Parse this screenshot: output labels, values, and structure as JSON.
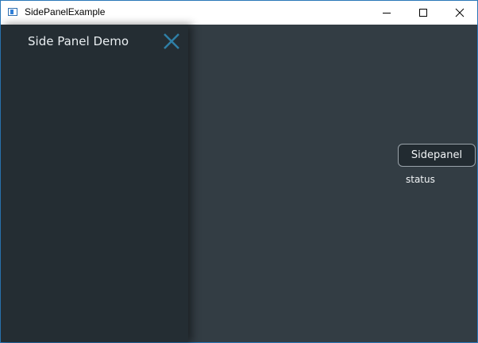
{
  "window": {
    "title": "SidePanelExample"
  },
  "sidepanel": {
    "title": "Side Panel Demo",
    "close_icon": "close-icon",
    "accent_color": "#2f7fa6",
    "background": "#242d33"
  },
  "main": {
    "background": "#333d44",
    "button_label": "Sidepanel",
    "status_text": "status"
  }
}
